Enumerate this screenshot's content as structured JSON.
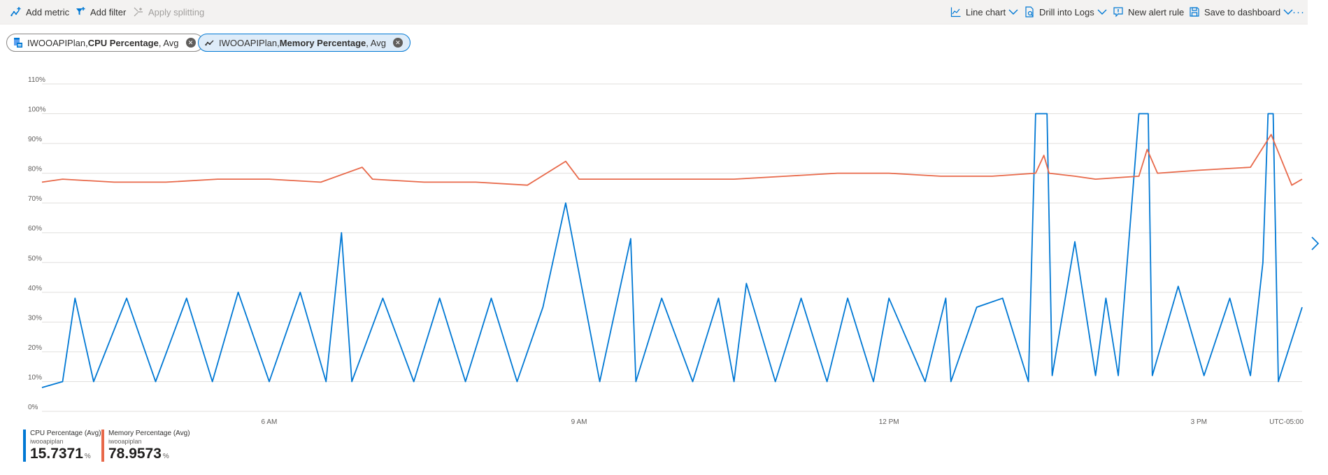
{
  "toolbar": {
    "add_metric": "Add metric",
    "add_filter": "Add filter",
    "apply_splitting": "Apply splitting",
    "line_chart": "Line chart",
    "drill_into_logs": "Drill into Logs",
    "new_alert_rule": "New alert rule",
    "save_to_dashboard": "Save to dashboard",
    "more": "···"
  },
  "pills": [
    {
      "resource": "IWOOAPIPlan, ",
      "metric": "CPU Percentage",
      "agg": ", Avg",
      "icon": "app-service-plan-icon"
    },
    {
      "resource": "IWOOAPIPlan, ",
      "metric": "Memory Percentage",
      "agg": ", Avg",
      "icon": "metric-line-icon"
    }
  ],
  "chart_data": {
    "type": "line",
    "y_ticks": [
      "0%",
      "10%",
      "20%",
      "30%",
      "40%",
      "50%",
      "60%",
      "70%",
      "80%",
      "90%",
      "100%",
      "110%"
    ],
    "ylim": [
      0,
      110
    ],
    "x_ticks": [
      "6 AM",
      "9 AM",
      "12 PM",
      "3 PM"
    ],
    "timezone": "UTC-05:00",
    "x_range_hours": [
      3.8,
      16.0
    ],
    "grid": true,
    "series": [
      {
        "name": "CPU Percentage (Avg)",
        "color": "#0078d4",
        "x_hours": [
          3.8,
          4.0,
          4.12,
          4.3,
          4.62,
          4.9,
          5.2,
          5.45,
          5.7,
          6.0,
          6.3,
          6.55,
          6.7,
          6.8,
          7.1,
          7.4,
          7.65,
          7.9,
          8.15,
          8.4,
          8.65,
          8.87,
          9.2,
          9.5,
          9.55,
          9.8,
          10.1,
          10.35,
          10.5,
          10.62,
          10.9,
          11.15,
          11.4,
          11.6,
          11.85,
          12.0,
          12.35,
          12.55,
          12.6,
          12.85,
          13.1,
          13.35,
          13.42,
          13.48,
          13.53,
          13.58,
          13.8,
          14.0,
          14.1,
          14.22,
          14.42,
          14.46,
          14.51,
          14.55,
          14.8,
          15.05,
          15.3,
          15.5,
          15.62,
          15.67,
          15.72,
          15.77,
          16.0
        ],
        "y": [
          8,
          10,
          38,
          10,
          38,
          10,
          38,
          10,
          40,
          10,
          40,
          10,
          60,
          10,
          38,
          10,
          38,
          10,
          38,
          10,
          35,
          70,
          10,
          58,
          10,
          38,
          10,
          38,
          10,
          43,
          10,
          38,
          10,
          38,
          10,
          38,
          10,
          38,
          10,
          35,
          38,
          10,
          100,
          100,
          100,
          12,
          57,
          12,
          38,
          12,
          100,
          100,
          100,
          12,
          42,
          12,
          38,
          12,
          50,
          100,
          100,
          10,
          35
        ]
      },
      {
        "name": "Memory Percentage (Avg)",
        "color": "#e8694a",
        "x_hours": [
          3.8,
          4.0,
          4.5,
          5.0,
          5.5,
          6.0,
          6.5,
          6.9,
          7.0,
          7.5,
          8.0,
          8.5,
          8.87,
          9.0,
          9.5,
          10.0,
          10.5,
          11.0,
          11.5,
          12.0,
          12.5,
          13.0,
          13.42,
          13.5,
          13.55,
          13.8,
          14.0,
          14.42,
          14.5,
          14.6,
          15.0,
          15.5,
          15.7,
          15.9,
          16.0
        ],
        "y": [
          77,
          78,
          77,
          77,
          78,
          78,
          77,
          82,
          78,
          77,
          77,
          76,
          84,
          78,
          78,
          78,
          78,
          79,
          80,
          80,
          79,
          79,
          80,
          86,
          80,
          79,
          78,
          79,
          88,
          80,
          81,
          82,
          93,
          76,
          78
        ]
      }
    ]
  },
  "legend": [
    {
      "title": "CPU Percentage (Avg)",
      "subtitle": "iwooapiplan",
      "value": "15.7371",
      "unit": "%",
      "color": "#0078d4"
    },
    {
      "title": "Memory Percentage (Avg)",
      "subtitle": "iwooapiplan",
      "value": "78.9573",
      "unit": "%",
      "color": "#e8694a"
    }
  ]
}
